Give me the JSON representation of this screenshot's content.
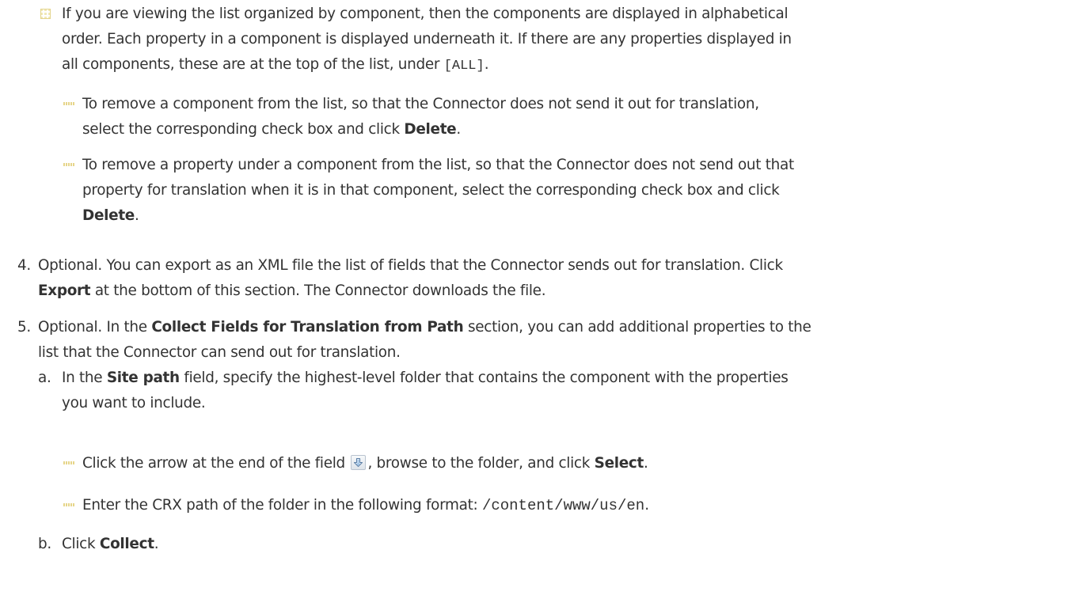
{
  "bullet1": {
    "line1": "If you are viewing the list organized by component, then the components are displayed in alphabetical",
    "line2": "order. Each property in a component is displayed underneath it. If there are any properties displayed in",
    "line3_pre": "all components, these are at the top of the list, under ",
    "line3_code": "[ALL]",
    "line3_post": "."
  },
  "sub1": {
    "line1": "To remove a component from the list, so that the Connector does not send it out for translation,",
    "line2_pre": "select the corresponding check box and click ",
    "line2_bold": "Delete",
    "line2_post": "."
  },
  "sub2": {
    "line1": "To remove a property under a component from the list, so that the Connector does not send out that",
    "line2": "property for translation when it is in that component, select the corresponding check box and click",
    "line3_bold": "Delete",
    "line3_post": "."
  },
  "step4": {
    "number": "4.",
    "line1": "Optional. You can export as an XML file the list of fields that the Connector sends out for translation. Click",
    "line2_bold": "Export",
    "line2_post": " at the bottom of this section. The Connector downloads the file."
  },
  "step5": {
    "number": "5.",
    "line1_pre": "Optional. In the ",
    "line1_bold": "Collect Fields for Translation from Path",
    "line1_post": " section, you can add additional properties to the",
    "line2": "list that the Connector can send out for translation."
  },
  "step5a": {
    "letter": "a.",
    "line1_pre": "In the ",
    "line1_bold": "Site path",
    "line1_post": " field, specify the highest-level folder that contains the component with the properties",
    "line2": "you want to include."
  },
  "sub3": {
    "pre": "Click the arrow at the end of the field ",
    "icon": "down-arrow-icon",
    "mid": ", browse to the folder, and click ",
    "bold": "Select",
    "post": "."
  },
  "sub4": {
    "pre": "Enter the CRX path of the folder in the following format: ",
    "code": "/content/www/us/en",
    "post": "."
  },
  "step5b": {
    "letter": "b.",
    "pre": "Click ",
    "bold": "Collect",
    "post": "."
  }
}
